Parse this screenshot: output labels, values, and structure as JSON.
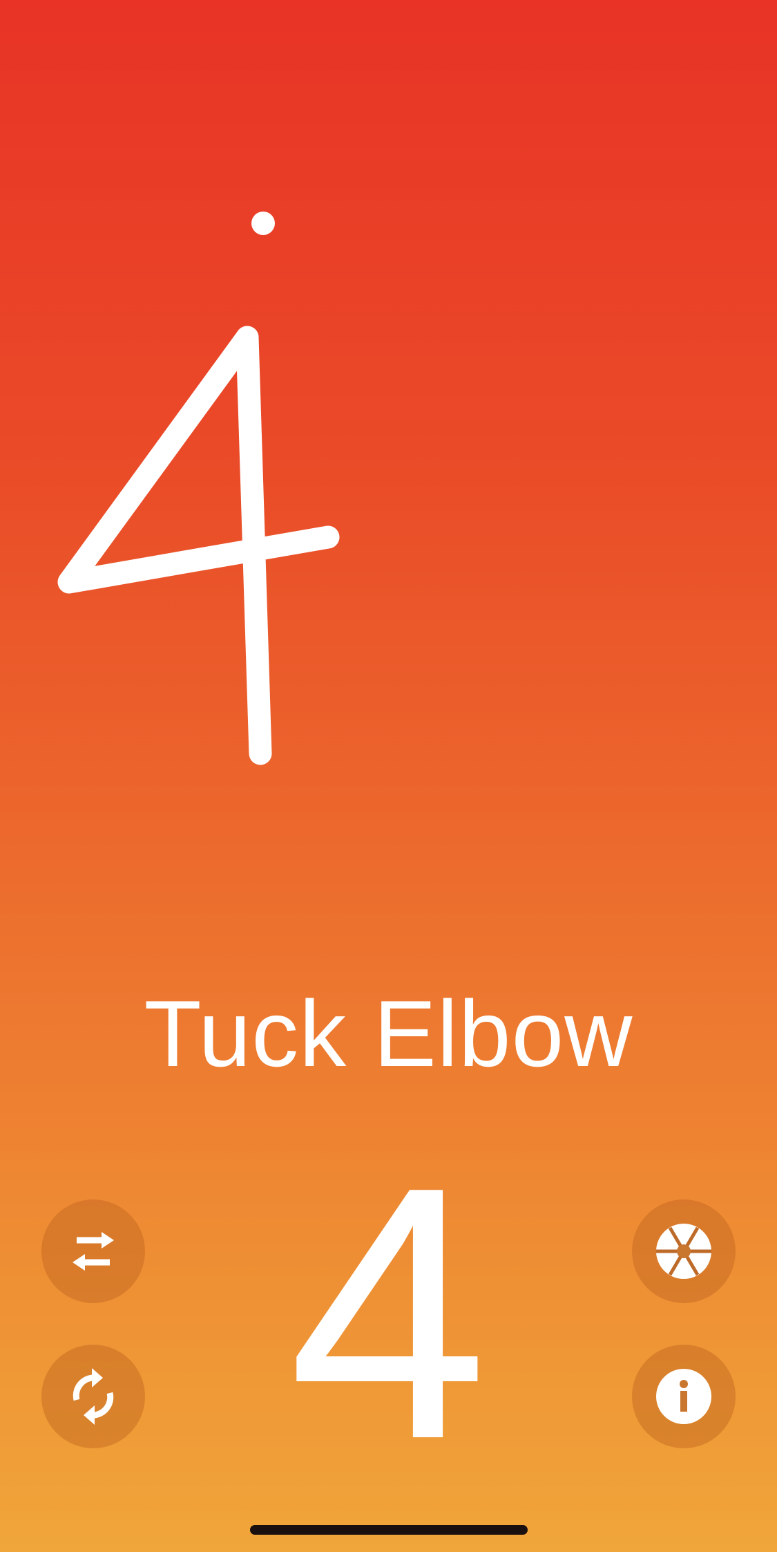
{
  "screen": {
    "colors": {
      "gradient_top": "#e83326",
      "gradient_bottom": "#f0a63a",
      "foreground": "#ffffff",
      "button_fill": "#be641e"
    }
  },
  "drawn_glyph": {
    "character": "4",
    "icon": "handwritten-four-stroke"
  },
  "exercise": {
    "name": "Tuck Elbow",
    "count": "4"
  },
  "controls": {
    "swap": {
      "icon": "swap-arrows-icon"
    },
    "repeat": {
      "icon": "repeat-cycle-icon"
    },
    "shutter": {
      "icon": "aperture-icon"
    },
    "info": {
      "icon": "info-icon"
    }
  }
}
